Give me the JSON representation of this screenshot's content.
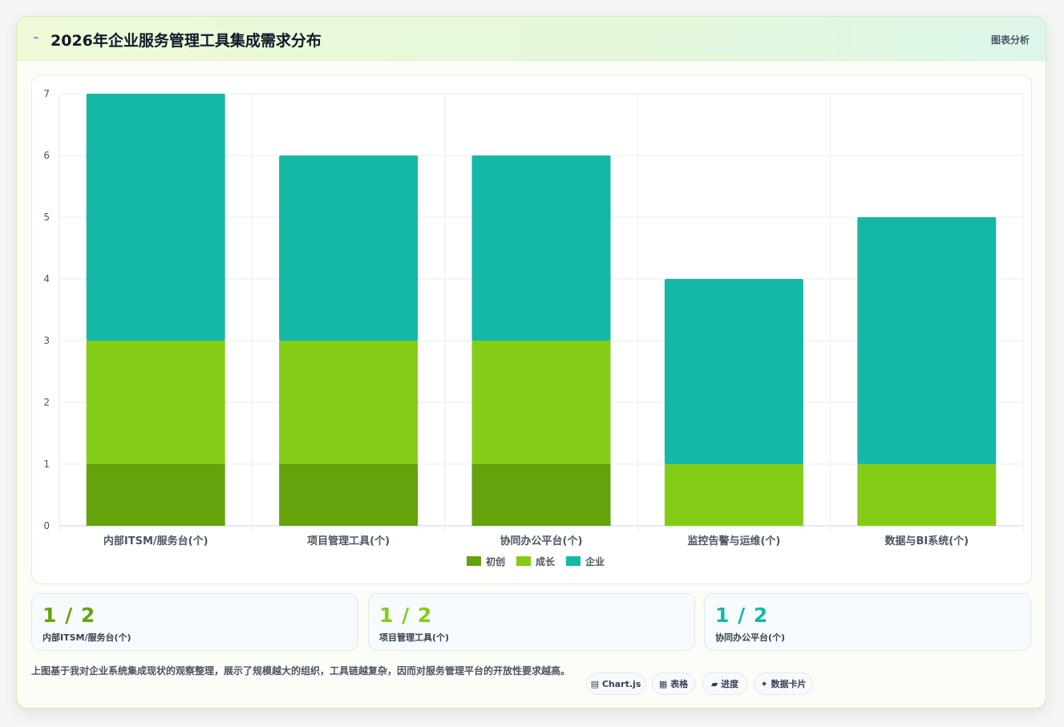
{
  "header": {
    "icon": "⌁",
    "title": "2026年企业服务管理工具集成需求分布",
    "right_label": "图表分析"
  },
  "colors": {
    "s1": "#65a30d",
    "s2": "#84cc16",
    "s3": "#14b8a6"
  },
  "chart_data": {
    "type": "bar",
    "stacked": true,
    "categories": [
      "内部ITSM/服务台(个)",
      "项目管理工具(个)",
      "协同办公平台(个)",
      "监控告警与运维(个)",
      "数据与BI系统(个)"
    ],
    "series": [
      {
        "name": "初创",
        "values": [
          1,
          1,
          1,
          0,
          0
        ]
      },
      {
        "name": "成长",
        "values": [
          2,
          2,
          2,
          1,
          1
        ]
      },
      {
        "name": "企业",
        "values": [
          4,
          3,
          3,
          3,
          4
        ]
      }
    ],
    "ylim": [
      0,
      7
    ],
    "yticks": [
      "0",
      "1",
      "2",
      "3",
      "4",
      "5",
      "6",
      "7"
    ],
    "grid": true,
    "legend": "bottom"
  },
  "stats": [
    {
      "value": "1 / 2",
      "label": "内部ITSM/服务台(个)"
    },
    {
      "value": "1 / 2",
      "label": "项目管理工具(个)"
    },
    {
      "value": "1 / 2",
      "label": "协同办公平台(个)"
    }
  ],
  "note": "上图基于我对企业系统集成现状的观察整理，展示了规模越大的组织，工具链越复杂，因而对服务管理平台的开放性要求越高。",
  "tags": [
    {
      "icon": "▤",
      "label": "Chart.js"
    },
    {
      "icon": "▦",
      "label": "表格"
    },
    {
      "icon": "▰",
      "label": "进度"
    },
    {
      "icon": "✦",
      "label": "数据卡片"
    }
  ]
}
